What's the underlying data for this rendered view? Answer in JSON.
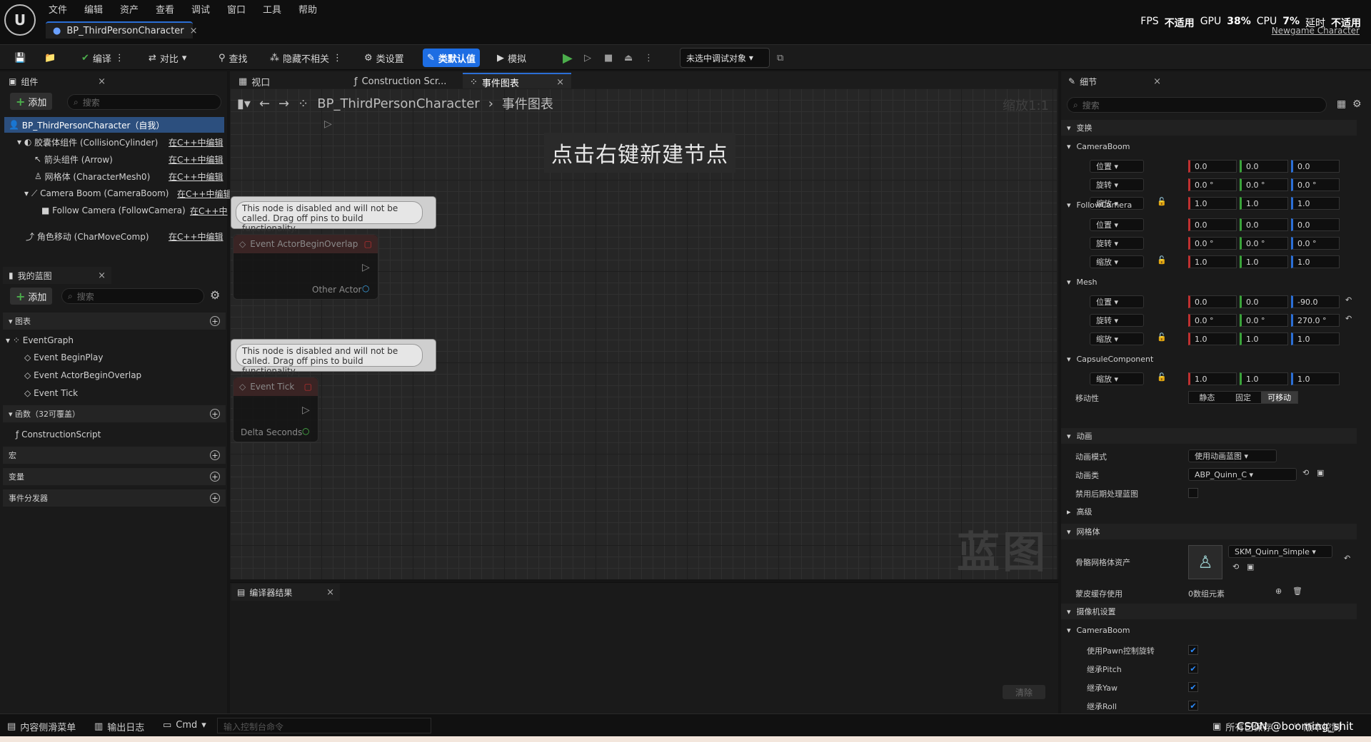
{
  "menu": [
    "文件",
    "编辑",
    "资产",
    "查看",
    "调试",
    "窗口",
    "工具",
    "帮助"
  ],
  "doc_tab": "BP_ThirdPersonCharacter",
  "stats": {
    "fps_label": "FPS",
    "fps": "不适用",
    "gpu_label": "GPU",
    "gpu": "38%",
    "cpu_label": "CPU",
    "cpu": "7%",
    "delay_label": "延时",
    "delay": "不适用",
    "newgame": "Newgame Character"
  },
  "toolbar": {
    "compile": "编译",
    "diff": "对比",
    "find": "查找",
    "hide": "隐藏不相关",
    "class_settings": "类设置",
    "class_defaults": "类默认值",
    "simulate": "模拟",
    "debug_target": "未选中调试对象"
  },
  "components": {
    "title": "组件",
    "add": "添加",
    "search": "搜索",
    "items": [
      {
        "name": "BP_ThirdPersonCharacter（自我）",
        "cpp": ""
      },
      {
        "name": "胶囊体组件 (CollisionCylinder)",
        "cpp": "在C++中编辑"
      },
      {
        "name": "箭头组件 (Arrow)",
        "cpp": "在C++中编辑"
      },
      {
        "name": "网格体 (CharacterMesh0)",
        "cpp": "在C++中编辑"
      },
      {
        "name": "Camera Boom (CameraBoom)",
        "cpp": "在C++中编辑"
      },
      {
        "name": "Follow Camera (FollowCamera)",
        "cpp": "在C++中"
      },
      {
        "name": "角色移动 (CharMoveComp)",
        "cpp": "在C++中编辑"
      }
    ]
  },
  "myblueprint": {
    "title": "我的蓝图",
    "add": "添加",
    "search": "搜索",
    "graphs_label": "图表",
    "event_graph": "EventGraph",
    "events": [
      "Event BeginPlay",
      "Event ActorBeginOverlap",
      "Event Tick"
    ],
    "functions_label": "函数（32可覆盖）",
    "construction": "ConstructionScript",
    "macros": "宏",
    "variables": "变量",
    "dispatchers": "事件分发器"
  },
  "graph": {
    "tabs": [
      "视口",
      "Construction Scr...",
      "事件图表"
    ],
    "crumb_bp": "BP_ThirdPersonCharacter",
    "crumb_graph": "事件图表",
    "zoom": "缩放1:1",
    "hint": "点击右键新建节点",
    "watermark": "蓝图",
    "disabled_note": "This node is disabled and will not be called. Drag off pins to build functionality.",
    "node1_title": "Event ActorBeginOverlap",
    "node1_pin": "Other Actor",
    "node2_title": "Event Tick",
    "node2_pin": "Delta Seconds"
  },
  "compiler": {
    "title": "编译器结果",
    "clear": "清除"
  },
  "details": {
    "title": "细节",
    "search": "搜索",
    "transform": "变换",
    "loc": "位置",
    "rot": "旋转",
    "scale": "缩放",
    "cameraboom": "CameraBoom",
    "followcamera": "FollowCamera",
    "mesh": "Mesh",
    "capsule": "CapsuleComponent",
    "cb_loc": [
      "0.0",
      "0.0",
      "0.0"
    ],
    "cb_rot": [
      "0.0 °",
      "0.0 °",
      "0.0 °"
    ],
    "cb_scale": [
      "1.0",
      "1.0",
      "1.0"
    ],
    "fc_loc": [
      "0.0",
      "0.0",
      "0.0"
    ],
    "fc_rot": [
      "0.0 °",
      "0.0 °",
      "0.0 °"
    ],
    "fc_scale": [
      "1.0",
      "1.0",
      "1.0"
    ],
    "m_loc": [
      "0.0",
      "0.0",
      "-90.0"
    ],
    "m_rot": [
      "0.0 °",
      "0.0 °",
      "270.0 °"
    ],
    "m_scale": [
      "1.0",
      "1.0",
      "1.0"
    ],
    "c_scale": [
      "1.0",
      "1.0",
      "1.0"
    ],
    "mobility": "移动性",
    "mob_static": "静态",
    "mob_stationary": "固定",
    "mob_movable": "可移动",
    "animation": "动画",
    "anim_mode": "动画模式",
    "anim_mode_val": "使用动画蓝图",
    "anim_class": "动画类",
    "anim_class_val": "ABP_Quinn_C",
    "disable_post": "禁用后期处理蓝图",
    "advanced": "高级",
    "mesh_section": "网格体",
    "skel_mesh": "骨骼网格体资产",
    "skel_mesh_val": "SKM_Quinn_Simple",
    "skin_cache": "蒙皮缓存使用",
    "skin_cache_val": "0数组元素",
    "camera_settings": "摄像机设置",
    "cb2": "CameraBoom",
    "use_pawn": "使用Pawn控制旋转",
    "inherit_pitch": "继承Pitch",
    "inherit_yaw": "继承Yaw",
    "inherit_roll": "继承Roll"
  },
  "statusbar": {
    "content": "内容侧滑菜单",
    "output": "输出日志",
    "cmd": "Cmd",
    "console_ph": "输入控制台命令",
    "source": "所有已保存",
    "version": "版本控制",
    "credit": "CSDN @booming_shit"
  }
}
